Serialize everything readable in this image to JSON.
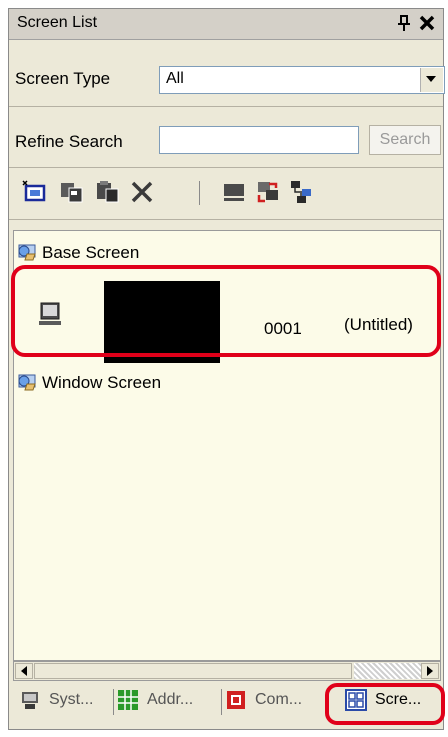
{
  "panel": {
    "title": "Screen List"
  },
  "filter": {
    "screen_type_label": "Screen Type",
    "screen_type_value": "All",
    "refine_label": "Refine Search",
    "refine_value": "",
    "search_button": "Search"
  },
  "toolbar": {
    "buttons": [
      "new-screen-icon",
      "copy-screen-icon",
      "paste-screen-icon",
      "delete-icon",
      "screen-properties-icon",
      "screen-transfer-icon",
      "screen-structure-icon"
    ]
  },
  "tree": {
    "base_screen_label": "Base Screen",
    "window_screen_label": "Window Screen",
    "screens": [
      {
        "number": "0001",
        "name": "(Untitled)"
      }
    ]
  },
  "tabs": [
    {
      "label": "Syst...",
      "icon": "system-icon"
    },
    {
      "label": "Addr...",
      "icon": "address-icon"
    },
    {
      "label": "Com...",
      "icon": "common-icon"
    },
    {
      "label": "Scre...",
      "icon": "screen-list-icon"
    }
  ],
  "colors": {
    "highlight": "#e0001a",
    "panel_bg": "#ece9d8",
    "tree_bg": "#fcfbe8"
  }
}
